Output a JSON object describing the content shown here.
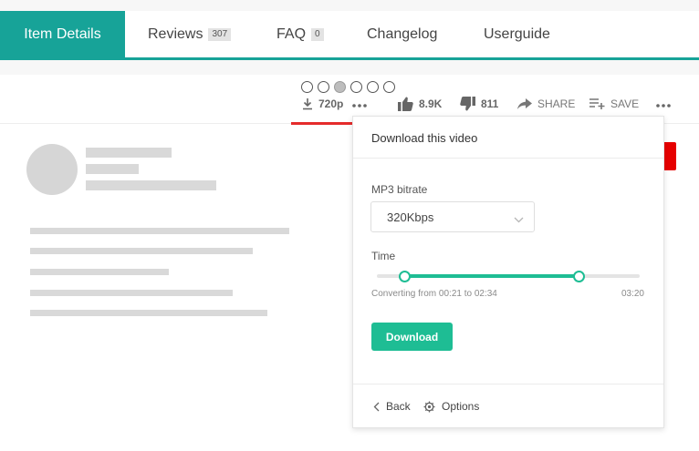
{
  "tabs": [
    {
      "label": "Item Details",
      "badge": ""
    },
    {
      "label": "Reviews",
      "badge": "307"
    },
    {
      "label": "FAQ",
      "badge": "0"
    },
    {
      "label": "Changelog",
      "badge": ""
    },
    {
      "label": "Userguide",
      "badge": ""
    }
  ],
  "active_tab": "Item Details",
  "toolbar": {
    "quality": "720p",
    "likes": "8.9K",
    "dislikes": "811",
    "share": "SHARE",
    "save": "SAVE",
    "dots_total": 6,
    "dots_selected_index": 2
  },
  "popup": {
    "title": "Download this video",
    "bitrate_label": "MP3 bitrate",
    "bitrate_value": "320Kbps",
    "time_label": "Time",
    "converting_text": "Converting from 00:21 to 02:34",
    "duration": "03:20",
    "range_start_fraction": 0.105,
    "range_end_fraction": 0.77,
    "download_button": "Download",
    "back_label": "Back",
    "options_label": "Options"
  },
  "colors": {
    "accent": "#17a398",
    "green": "#1ebd94",
    "red": "#e60000",
    "placeholder": "#d9d9d9"
  },
  "icons": [
    "download-icon",
    "more-horizontal-icon",
    "thumbs-up-icon",
    "thumbs-down-icon",
    "share-arrow-icon",
    "playlist-add-icon",
    "chevron-down-icon",
    "chevron-left-icon",
    "gear-icon"
  ]
}
